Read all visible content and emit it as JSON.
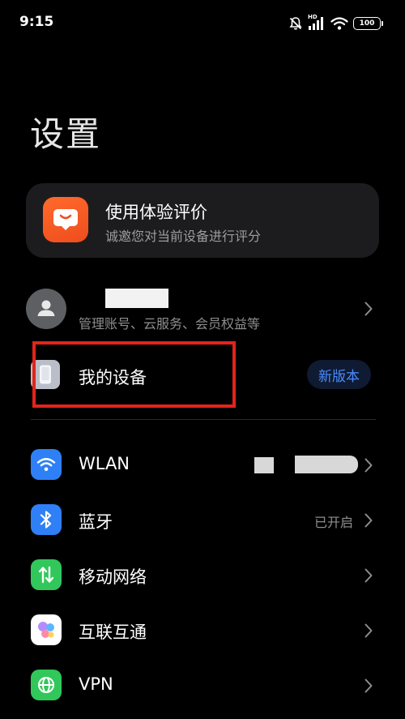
{
  "status_bar": {
    "time": "9:15",
    "hd_label": "HD",
    "battery_level": "100",
    "icons": [
      "mute-bell-icon",
      "signal-icon",
      "wifi-icon",
      "battery-icon"
    ]
  },
  "page_title": "设置",
  "feedback": {
    "title": "使用体验评价",
    "subtitle": "诚邀您对当前设备进行评分",
    "icon": "feedback-chat-icon",
    "accent": "#FF5F28"
  },
  "account": {
    "subtitle": "管理账号、云服务、会员权益等",
    "icon": "user-avatar-icon"
  },
  "my_device": {
    "label": "我的设备",
    "badge": "新版本",
    "badge_color": "#4A8DFF",
    "highlight_color": "#E3241A"
  },
  "settings": [
    {
      "label": "WLAN",
      "value": "",
      "icon": "wifi-icon",
      "icon_bg": "#2F80F6"
    },
    {
      "label": "蓝牙",
      "value": "已开启",
      "icon": "bluetooth-icon",
      "icon_bg": "#2F80F6"
    },
    {
      "label": "移动网络",
      "value": "",
      "icon": "mobile-data-icon",
      "icon_bg": "#31C75B"
    },
    {
      "label": "互联互通",
      "value": "",
      "icon": "interconnect-icon",
      "icon_bg": "#FFFFFF"
    },
    {
      "label": "VPN",
      "value": "",
      "icon": "globe-icon",
      "icon_bg": "#31C75B"
    }
  ]
}
